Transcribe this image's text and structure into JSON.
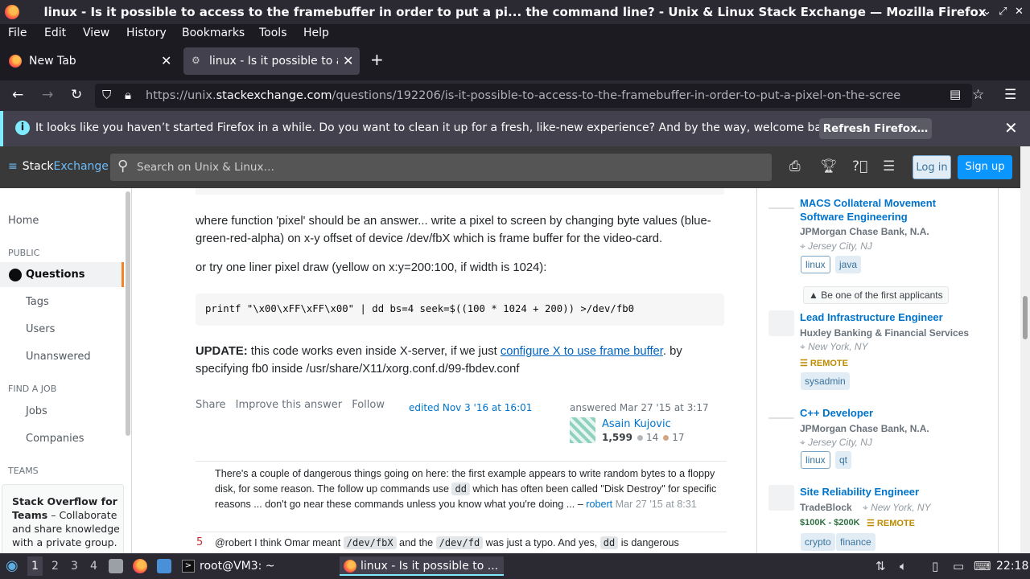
{
  "window": {
    "title": "linux - Is it possible to access to the framebuffer in order to put a pi... the command line? - Unix & Linux Stack Exchange — Mozilla Firefox"
  },
  "menu": [
    "File",
    "Edit",
    "View",
    "History",
    "Bookmarks",
    "Tools",
    "Help"
  ],
  "tabs": [
    {
      "label": "New Tab"
    },
    {
      "label": "linux - Is it possible to acc"
    }
  ],
  "url": {
    "prefix": "https://unix.",
    "domain": "stackexchange.com",
    "path": "/questions/192206/is-it-possible-to-access-to-the-framebuffer-in-order-to-put-a-pixel-on-the-scree"
  },
  "notification": {
    "message": "It looks like you haven’t started Firefox in a while. Do you want to clean it up for a fresh, like-new experience? And by the way, welcome back!",
    "button": "Refresh Firefox…"
  },
  "se_header": {
    "logo_a": "Stack",
    "logo_b": "Exchange",
    "search_placeholder": "Search on Unix & Linux…",
    "login": "Log in",
    "signup": "Sign up"
  },
  "sidebar": {
    "home": "Home",
    "public": "PUBLIC",
    "questions": "Questions",
    "tags": "Tags",
    "users": "Users",
    "unanswered": "Unanswered",
    "find_job": "FIND A JOB",
    "jobs": "Jobs",
    "companies": "Companies",
    "teams": "TEAMS",
    "teams_title": "Stack Overflow for Teams",
    "teams_text": " – Collaborate and share knowledge with a private group."
  },
  "answer": {
    "p1": "where function 'pixel' should be an answer... write a pixel to screen by changing byte values (blue-green-red-alpha) on x-y offset of device /dev/fbX which is frame buffer for the video-card.",
    "p2": "or try one liner pixel draw (yellow on x:y=200:100, if width is 1024):",
    "code": "printf \"\\x00\\xFF\\xFF\\x00\" | dd bs=4 seek=$((100 * 1024 + 200)) >/dev/fb0",
    "update_label": "UPDATE:",
    "update_a": " this code works even inside X-server, if we just ",
    "update_link": "configure X to use frame buffer",
    "update_b": ". by specifying fb0 inside /usr/share/X11/xorg.conf.d/99-fbdev.conf",
    "share": "Share",
    "improve": "Improve this answer",
    "follow": "Follow",
    "edited": "edited Nov 3 '16 at 16:01",
    "answered": "answered Mar 27 '15 at 3:17",
    "user": "Asain Kujovic",
    "rep": "1,599",
    "silver": "14",
    "bronze": "17"
  },
  "comments": [
    {
      "text_a": "There's a couple of dangerous things going on here: the first example appears to write random bytes to a floppy disk, for some reason. The follow up commands use ",
      "code": "dd",
      "text_b": " which has often been called \"Disk Destroy\" for specific reasons ... don't go near these commands unless you know what you're doing ... – ",
      "user": "robert",
      "date": "Mar 27 '15 at 8:31"
    },
    {
      "score": "5",
      "text_a": "@robert I think Omar meant ",
      "code1": "/dev/fbX",
      "text_b": " and the ",
      "code2": "/dev/fd",
      "text_c": " was just a typo. And yes, ",
      "code3": "dd",
      "text_d": " is dangerous"
    }
  ],
  "jobs": [
    {
      "title": "MACS Collateral Movement Software Engineering",
      "company": "JPMorgan Chase Bank, N.A.",
      "location": "Jersey City, NJ",
      "tags": [
        "linux",
        "java"
      ],
      "note": "Be one of the first applicants"
    },
    {
      "title": "Lead Infrastructure Engineer",
      "company": "Huxley Banking & Financial Services",
      "location": "New York, NY",
      "remote": "REMOTE",
      "tags": [
        "sysadmin"
      ]
    },
    {
      "title": "C++ Developer",
      "company": "JPMorgan Chase Bank, N.A.",
      "location": "Jersey City, NJ",
      "tags": [
        "linux",
        "qt"
      ]
    },
    {
      "title": "Site Reliability Engineer",
      "company": "TradeBlock",
      "location": "New York, NY",
      "salary": "$100K - $200K",
      "remote": "REMOTE",
      "tags": [
        "crypto",
        "finance"
      ]
    }
  ],
  "taskbar": {
    "workspaces": [
      "1",
      "2",
      "3",
      "4"
    ],
    "terminal": "root@VM3: ~",
    "firefox": "linux - Is it possible to ...",
    "clock": "22:18"
  }
}
